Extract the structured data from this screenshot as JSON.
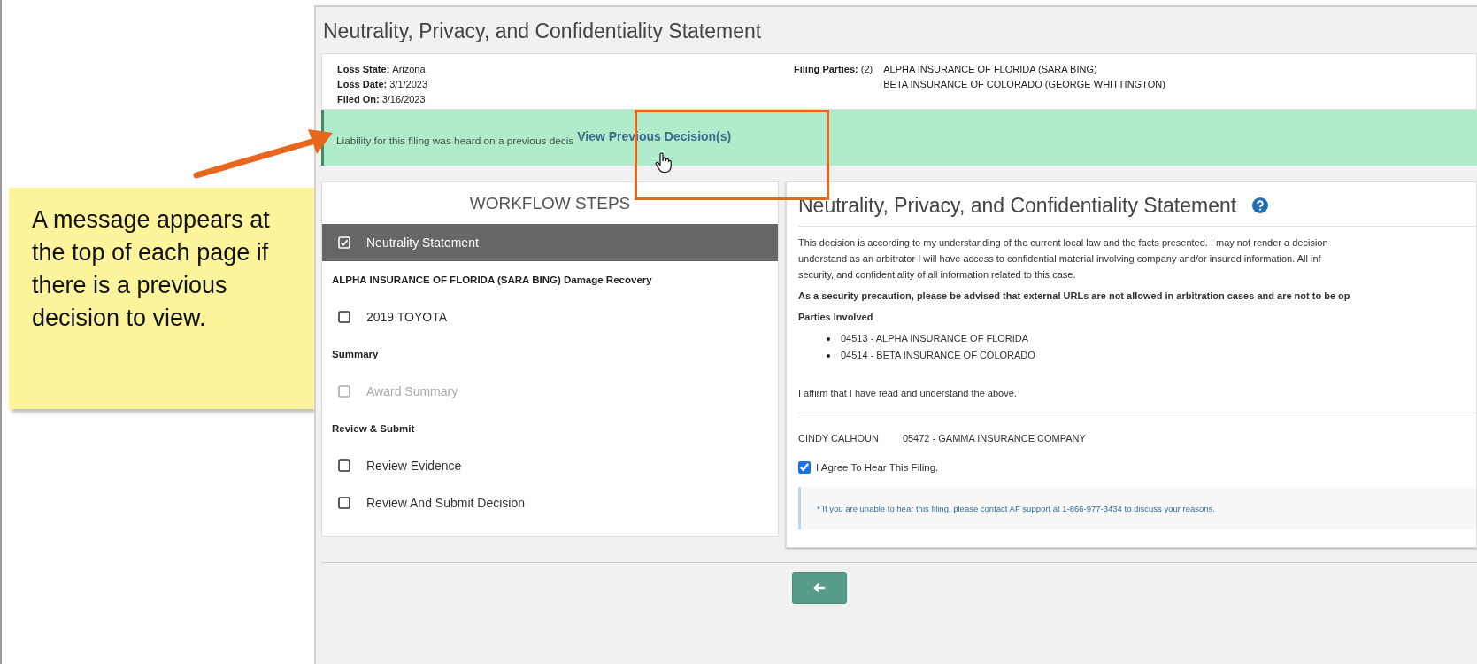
{
  "annotation": {
    "note": "A message appears at the top of each page if there is a previous decision to view."
  },
  "page": {
    "title": "Neutrality, Privacy, and Confidentiality Statement"
  },
  "filing_info": {
    "fields": [
      {
        "label": "Loss State:",
        "value": "Arizona"
      },
      {
        "label": "Loss Date:",
        "value": "3/1/2023"
      },
      {
        "label": "Filed On:",
        "value": "3/16/2023"
      }
    ],
    "parties_label": "Filing Parties:",
    "parties_count": "(2)",
    "parties": [
      "ALPHA INSURANCE OF FLORIDA (SARA BING)",
      "BETA INSURANCE OF COLORADO (GEORGE WHITTINGTON)"
    ]
  },
  "notice": {
    "text": "Liability for this filing was heard on a previous decis",
    "link": "View Previous Decision(s)"
  },
  "workflow": {
    "title": "WORKFLOW STEPS",
    "items": [
      {
        "kind": "step",
        "label": "Neutrality Statement",
        "checked": true,
        "selected": true,
        "disabled": false
      },
      {
        "kind": "heading",
        "label": "ALPHA INSURANCE OF FLORIDA (SARA BING) Damage Recovery"
      },
      {
        "kind": "step",
        "label": "2019 TOYOTA",
        "checked": false,
        "selected": false,
        "disabled": false
      },
      {
        "kind": "heading",
        "label": "Summary"
      },
      {
        "kind": "step",
        "label": "Award Summary",
        "checked": false,
        "selected": false,
        "disabled": true
      },
      {
        "kind": "heading",
        "label": "Review & Submit"
      },
      {
        "kind": "step",
        "label": "Review Evidence",
        "checked": false,
        "selected": false,
        "disabled": false
      },
      {
        "kind": "step",
        "label": "Review And Submit Decision",
        "checked": false,
        "selected": false,
        "disabled": false
      }
    ]
  },
  "statement": {
    "title": "Neutrality, Privacy, and Confidentiality Statement",
    "paragraph_lines": [
      "This decision is according to my understanding of the current local law and the facts presented. I may not render a decision",
      "understand as an arbitrator I will have access to confidential material involving company and/or insured information. All inf",
      "security, and confidentiality of all information related to this case."
    ],
    "precaution": "As a security precaution, please be advised that external URLs are not allowed in arbitration cases and are not to be op",
    "parties_heading": "Parties Involved",
    "parties": [
      "04513 - ALPHA INSURANCE OF FLORIDA",
      "04514 - BETA INSURANCE OF COLORADO"
    ],
    "affirm": "I affirm that I have read and understand the above.",
    "arbitrator_name": "CINDY CALHOUN",
    "arbitrator_company": "05472 - GAMMA INSURANCE COMPANY",
    "agree": {
      "label": "I Agree To Hear This Filing.",
      "checked": true
    },
    "support_note": "* If you are unable to hear this filing, please contact AF support at 1-866-977-3434 to discuss your reasons."
  }
}
